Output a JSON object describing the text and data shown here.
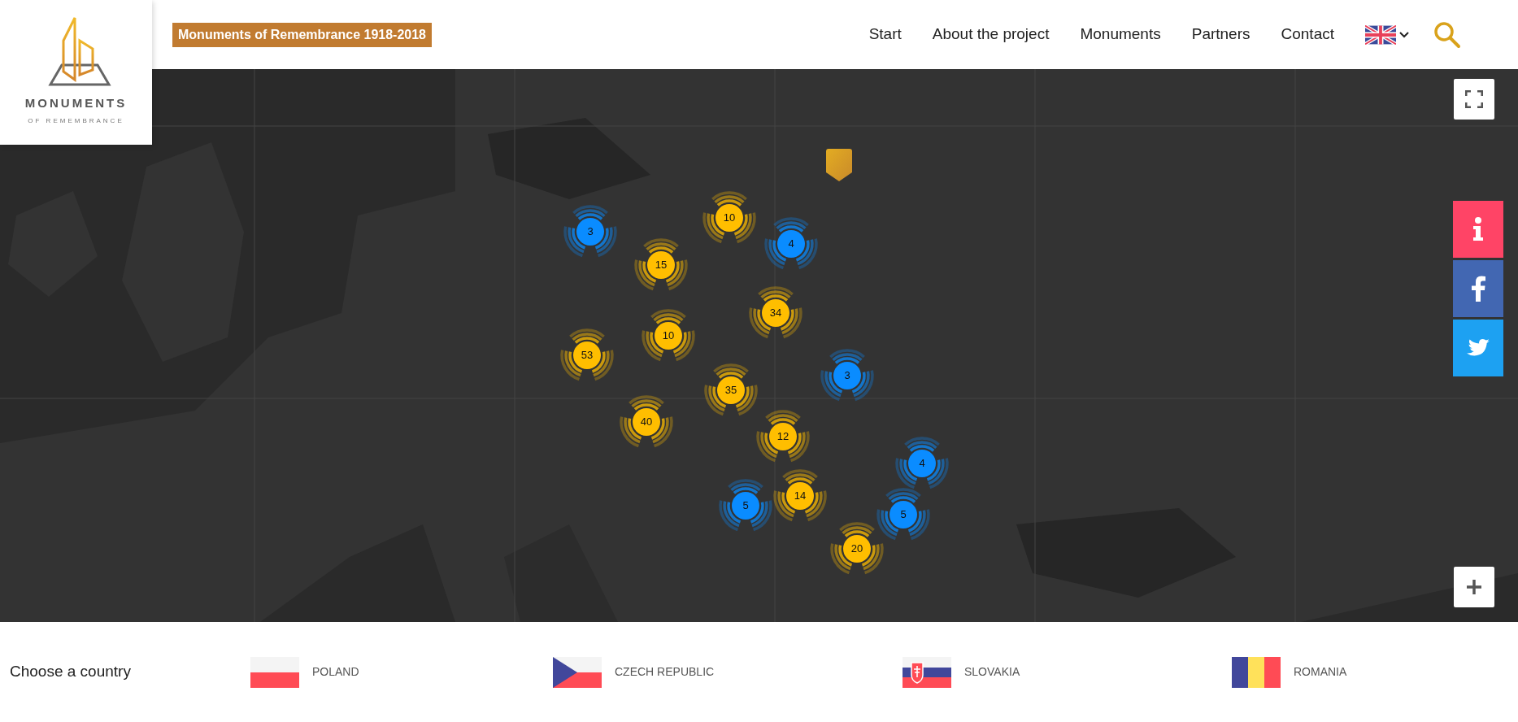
{
  "header": {
    "logo": {
      "name": "MONUMENTS",
      "tagline": "OF REMEMBRANCE"
    },
    "title": "Monuments of Remembrance 1918-2018",
    "nav": [
      {
        "label": "Start"
      },
      {
        "label": "About the project"
      },
      {
        "label": "Monuments"
      },
      {
        "label": "Partners"
      },
      {
        "label": "Contact"
      }
    ]
  },
  "map": {
    "markers": [
      {
        "count": "3",
        "color": "#0a8cff"
      },
      {
        "count": "10",
        "color": "#ffbe00"
      },
      {
        "count": "4",
        "color": "#0a8cff"
      },
      {
        "count": "15",
        "color": "#ffbe00"
      },
      {
        "count": "34",
        "color": "#ffbe00"
      },
      {
        "count": "10",
        "color": "#ffbe00"
      },
      {
        "count": "53",
        "color": "#ffbe00"
      },
      {
        "count": "3",
        "color": "#0a8cff"
      },
      {
        "count": "35",
        "color": "#ffbe00"
      },
      {
        "count": "40",
        "color": "#ffbe00"
      },
      {
        "count": "12",
        "color": "#ffbe00"
      },
      {
        "count": "4",
        "color": "#0a8cff"
      },
      {
        "count": "5",
        "color": "#0a8cff"
      },
      {
        "count": "14",
        "color": "#ffbe00"
      },
      {
        "count": "5",
        "color": "#0a8cff"
      },
      {
        "count": "20",
        "color": "#ffbe00"
      }
    ]
  },
  "side_buttons": [
    {
      "kind": "info"
    },
    {
      "kind": "facebook"
    },
    {
      "kind": "twitter"
    }
  ],
  "footer": {
    "label": "Choose a country",
    "countries": [
      {
        "name": "POLAND",
        "kind": "poland"
      },
      {
        "name": "CZECH REPUBLIC",
        "kind": "czech"
      },
      {
        "name": "SLOVAKIA",
        "kind": "slovakia"
      },
      {
        "name": "ROMANIA",
        "kind": "romania"
      }
    ]
  }
}
